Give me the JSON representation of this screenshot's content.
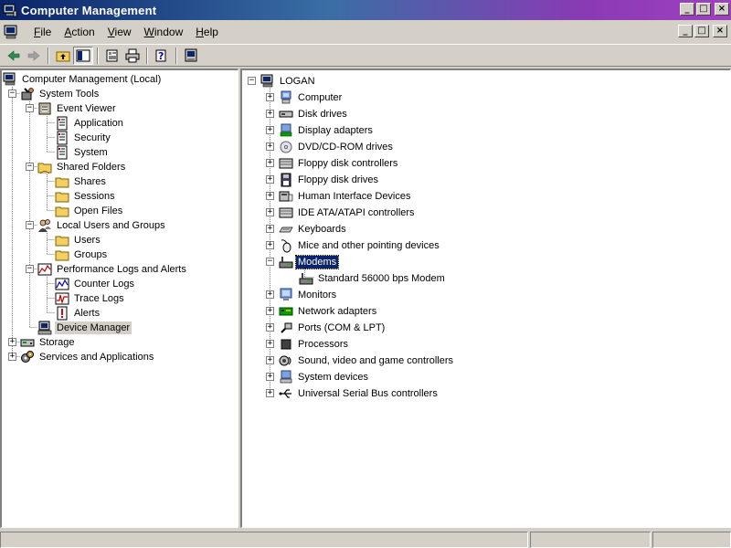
{
  "window": {
    "title": "Computer Management"
  },
  "window_buttons": {
    "minimize": "_",
    "maximize": "□",
    "close": "×"
  },
  "menu": [
    {
      "label": "File",
      "u": "F",
      "rest": "ile"
    },
    {
      "label": "Action",
      "u": "A",
      "rest": "ction"
    },
    {
      "label": "View",
      "u": "V",
      "rest": "iew"
    },
    {
      "label": "Window",
      "u": "W",
      "rest": "indow"
    },
    {
      "label": "Help",
      "u": "H",
      "rest": "elp"
    }
  ],
  "toolbar": {
    "buttons": [
      "back-icon",
      "forward-icon",
      "up-folder-icon",
      "show-hide-tree-icon",
      "properties-icon",
      "print-icon",
      "help-icon",
      "device-manager-icon"
    ]
  },
  "left_tree": {
    "root": "Computer Management (Local)",
    "system_tools": "System Tools",
    "event_viewer": "Event Viewer",
    "application": "Application",
    "security": "Security",
    "system": "System",
    "shared_folders": "Shared Folders",
    "shares": "Shares",
    "sessions": "Sessions",
    "open_files": "Open Files",
    "local_users_groups": "Local Users and Groups",
    "users": "Users",
    "groups": "Groups",
    "perf_logs": "Performance Logs and Alerts",
    "counter_logs": "Counter Logs",
    "trace_logs": "Trace Logs",
    "alerts": "Alerts",
    "device_manager": "Device Manager",
    "storage": "Storage",
    "services_apps": "Services and Applications"
  },
  "right_tree": {
    "root": "LOGAN",
    "items": [
      {
        "label": "Computer",
        "icon": "computer-icon"
      },
      {
        "label": "Disk drives",
        "icon": "disk-drive-icon"
      },
      {
        "label": "Display adapters",
        "icon": "display-adapter-icon"
      },
      {
        "label": "DVD/CD-ROM drives",
        "icon": "cdrom-icon"
      },
      {
        "label": "Floppy disk controllers",
        "icon": "controller-icon"
      },
      {
        "label": "Floppy disk drives",
        "icon": "floppy-icon"
      },
      {
        "label": "Human Interface Devices",
        "icon": "hid-icon"
      },
      {
        "label": "IDE ATA/ATAPI controllers",
        "icon": "controller-icon"
      },
      {
        "label": "Keyboards",
        "icon": "keyboard-icon"
      },
      {
        "label": "Mice and other pointing devices",
        "icon": "mouse-icon"
      },
      {
        "label": "Modems",
        "icon": "modem-icon"
      },
      {
        "label": "Standard 56000 bps Modem",
        "icon": "modem-icon"
      },
      {
        "label": "Monitors",
        "icon": "monitor-icon"
      },
      {
        "label": "Network adapters",
        "icon": "network-adapter-icon"
      },
      {
        "label": "Ports (COM & LPT)",
        "icon": "port-icon"
      },
      {
        "label": "Processors",
        "icon": "processor-icon"
      },
      {
        "label": "Sound, video and game controllers",
        "icon": "sound-icon"
      },
      {
        "label": "System devices",
        "icon": "system-devices-icon"
      },
      {
        "label": "Universal Serial Bus controllers",
        "icon": "usb-icon"
      }
    ]
  },
  "expanders": {
    "plus": "+",
    "minus": "−"
  },
  "colors": {
    "selection": "#0a246a",
    "chrome": "#d4d0c8",
    "title_start": "#0a246a",
    "title_end": "#a040c0"
  }
}
